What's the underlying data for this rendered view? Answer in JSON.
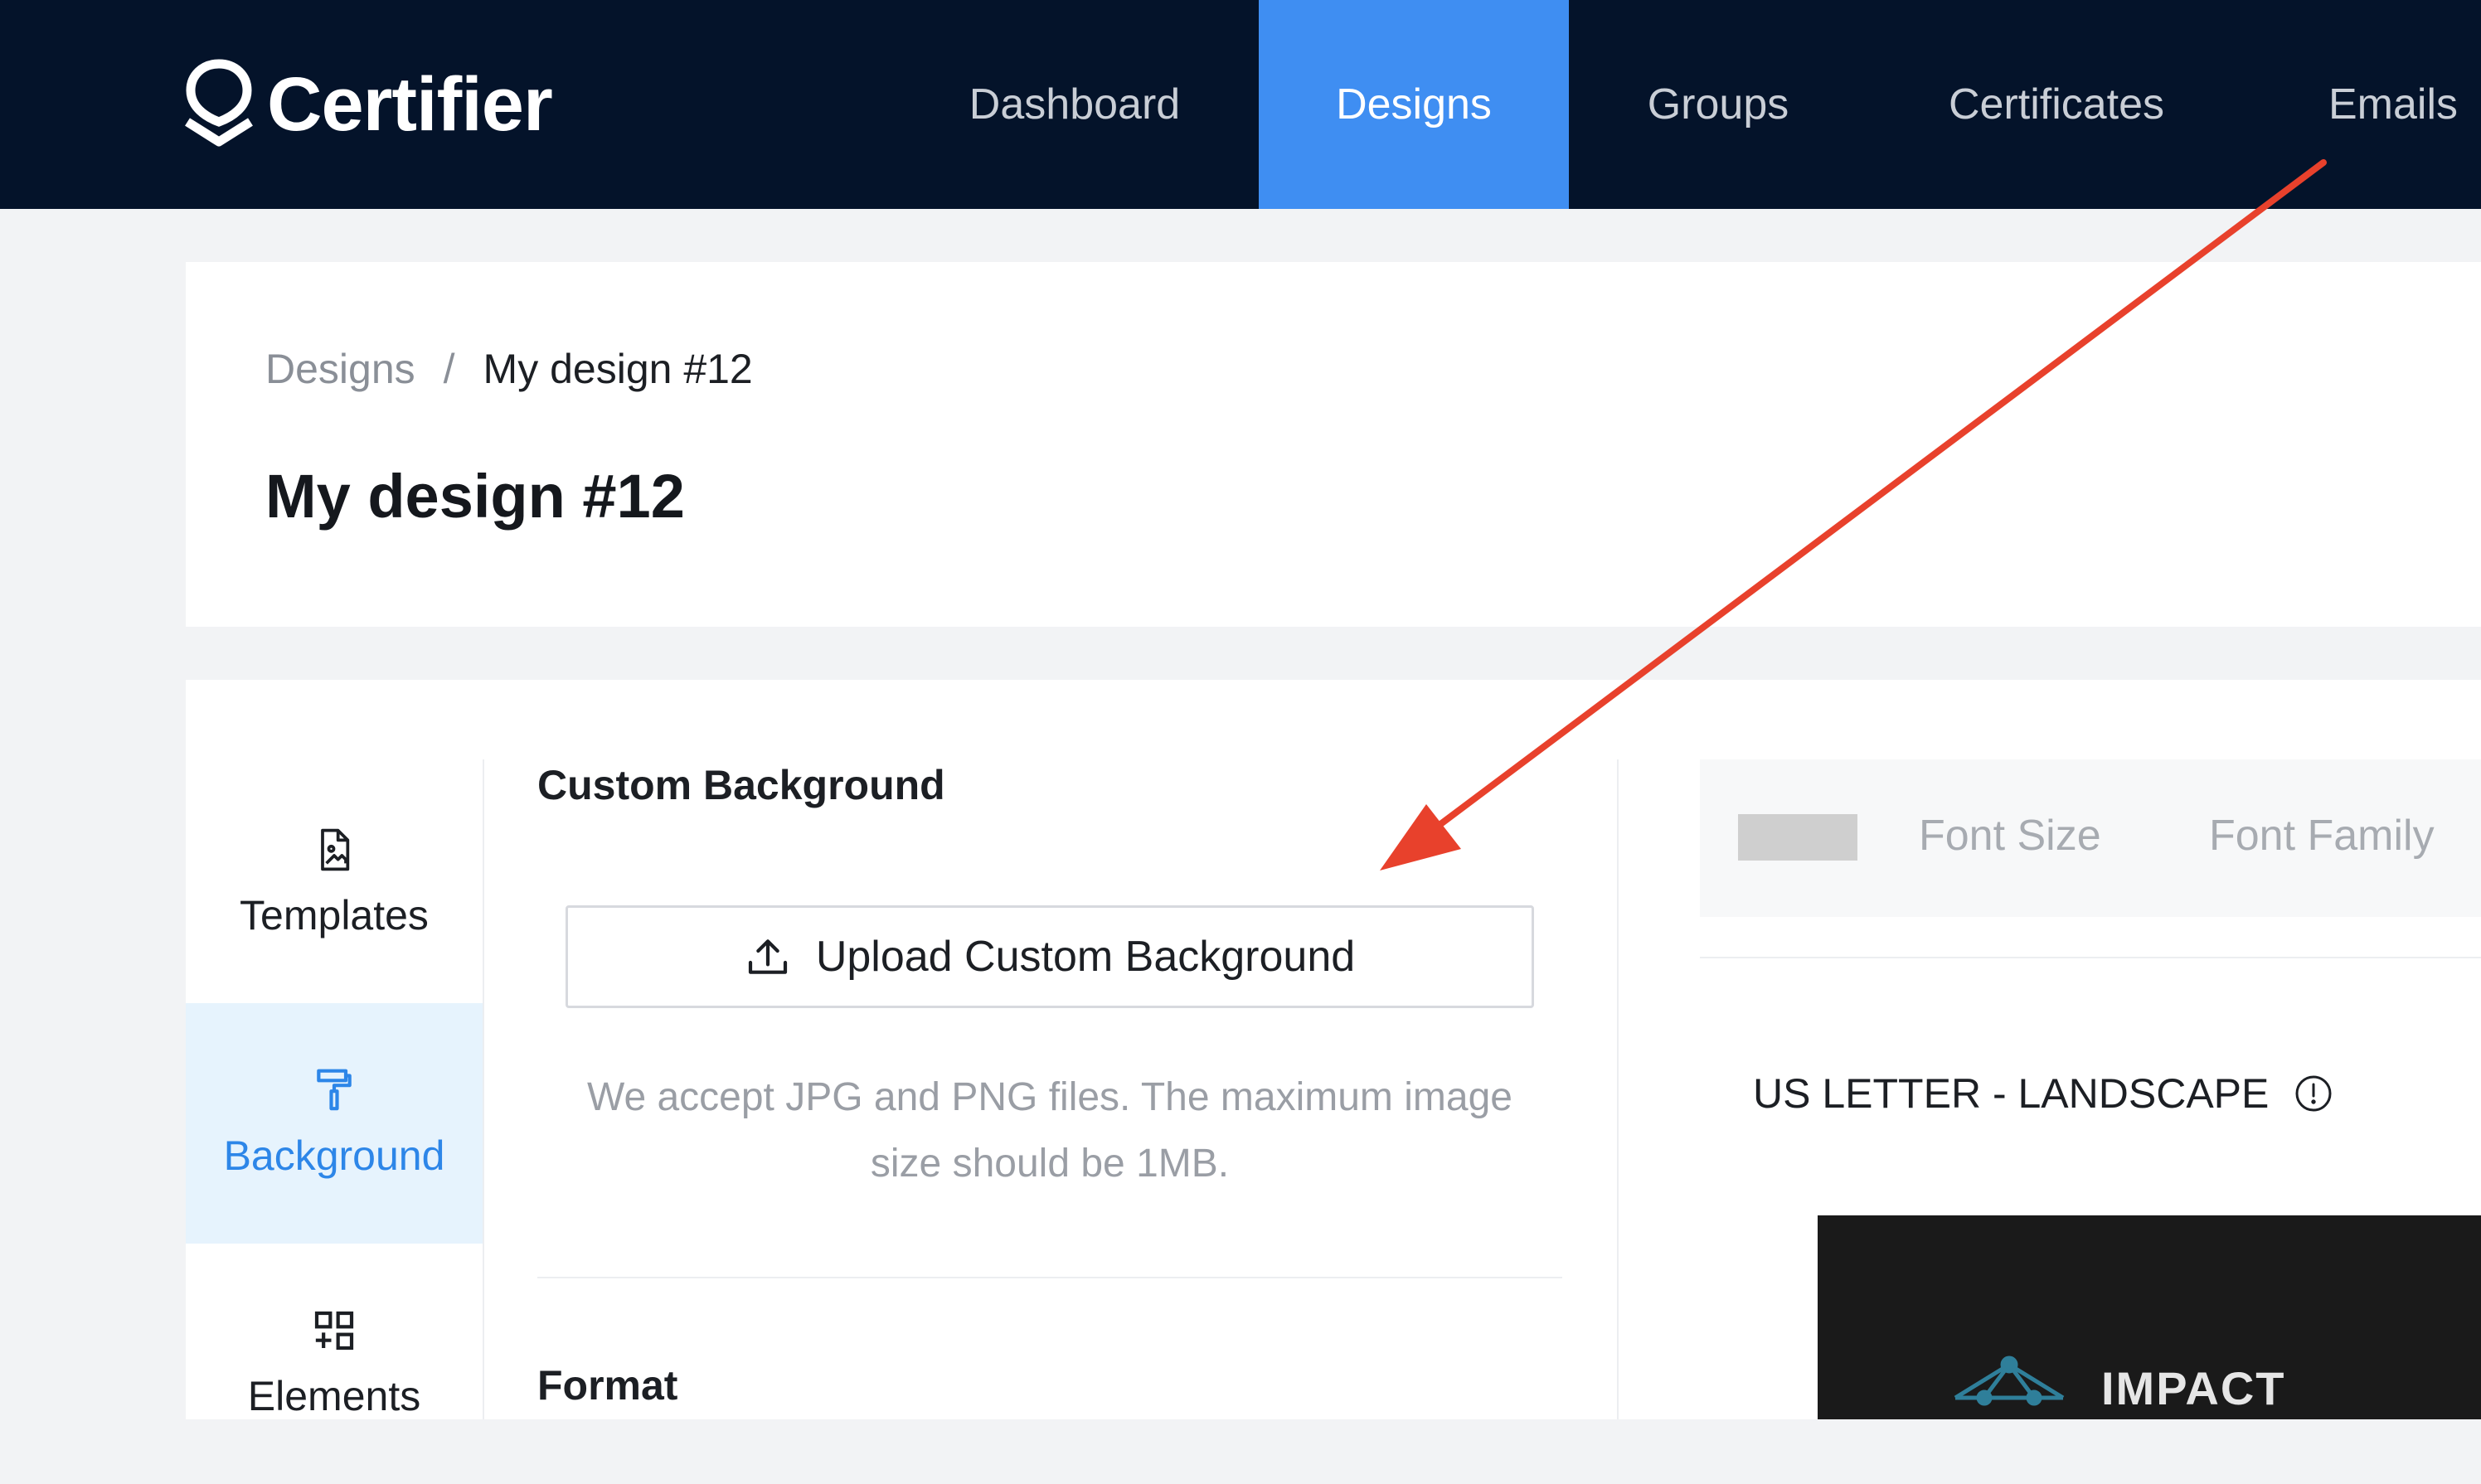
{
  "brand": {
    "name": "Certifier"
  },
  "nav": {
    "items": [
      {
        "label": "Dashboard",
        "active": false
      },
      {
        "label": "Designs",
        "active": true
      },
      {
        "label": "Groups",
        "active": false
      },
      {
        "label": "Certificates",
        "active": false
      },
      {
        "label": "Emails",
        "active": false
      }
    ]
  },
  "breadcrumb": {
    "parent": "Designs",
    "separator": "/",
    "current": "My design #12"
  },
  "page": {
    "title": "My design #12"
  },
  "sidebar": {
    "items": [
      {
        "label": "Templates",
        "icon": "file-image-icon",
        "active": false
      },
      {
        "label": "Background",
        "icon": "paint-roller-icon",
        "active": true
      },
      {
        "label": "Elements",
        "icon": "grid-plus-icon",
        "active": false
      }
    ]
  },
  "background_panel": {
    "heading": "Custom Background",
    "upload_button": "Upload Custom Background",
    "hint": "We accept JPG and PNG files. The maximum image size should be 1MB.",
    "next_heading": "Format"
  },
  "toolbar": {
    "swatch_color": "#cfcfcf",
    "font_size_label": "Font Size",
    "font_family_label": "Font Family"
  },
  "canvas": {
    "format": "US LETTER - LANDSCAPE",
    "preview_text": "IMPACT"
  },
  "annotation": {
    "arrow_color": "#e8412c"
  },
  "colors": {
    "nav_bg": "#04132a",
    "accent": "#3f8ef2",
    "active_side_bg": "#e6f3fd"
  }
}
